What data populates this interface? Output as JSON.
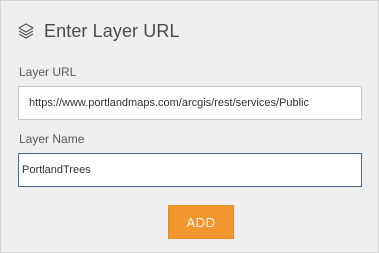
{
  "dialog": {
    "title": "Enter Layer URL",
    "icon": "layers-icon"
  },
  "layer_url": {
    "label": "Layer URL",
    "value": "https://www.portlandmaps.com/arcgis/rest/services/Public"
  },
  "layer_name": {
    "label": "Layer Name",
    "value": "PortlandTrees"
  },
  "actions": {
    "add_label": "ADD"
  },
  "colors": {
    "accent": "#f2962f",
    "panel_background": "#efefef",
    "focused_border": "#4a6b8e"
  }
}
